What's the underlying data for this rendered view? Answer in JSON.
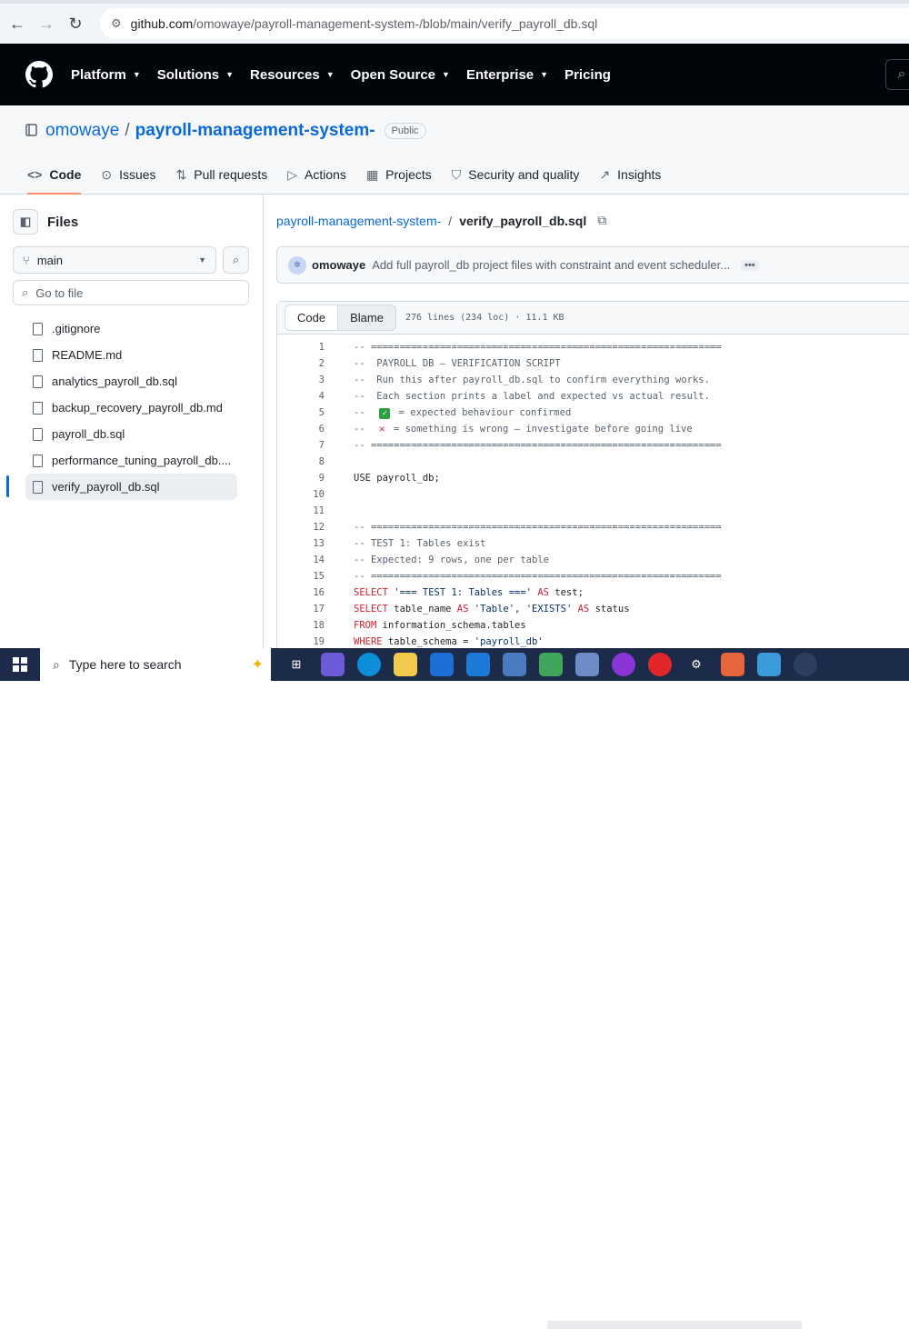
{
  "browser": {
    "url_host": "github.com",
    "url_path": "/omowaye/payroll-management-system-/blob/main/verify_payroll_db.sql"
  },
  "gh_nav": {
    "items": [
      "Platform",
      "Solutions",
      "Resources",
      "Open Source",
      "Enterprise",
      "Pricing"
    ]
  },
  "repo": {
    "owner": "omowaye",
    "name": "payroll-management-system-",
    "visibility": "Public"
  },
  "tabs": [
    "Code",
    "Issues",
    "Pull requests",
    "Actions",
    "Projects",
    "Security and quality",
    "Insights"
  ],
  "sidebar": {
    "title": "Files",
    "branch": "main",
    "goto_placeholder": "Go to file",
    "files": [
      ".gitignore",
      "README.md",
      "analytics_payroll_db.sql",
      "backup_recovery_payroll_db.md",
      "payroll_db.sql",
      "performance_tuning_payroll_db....",
      "verify_payroll_db.sql"
    ]
  },
  "breadcrumb": {
    "repo": "payroll-management-system-",
    "separator": "/",
    "file": "verify_payroll_db.sql"
  },
  "commit": {
    "author": "omowaye",
    "message": "Add full payroll_db project files with constraint and event scheduler...",
    "more": "•••"
  },
  "code_view": {
    "code_tab": "Code",
    "blame_tab": "Blame",
    "meta": "276 lines (234 loc) · 11.1 KB"
  },
  "code_lines": [
    {
      "n": "1",
      "t": "-- ============================================================="
    },
    {
      "n": "2",
      "t": "--  PAYROLL DB — VERIFICATION SCRIPT"
    },
    {
      "n": "3",
      "t": "--  Run this after payroll_db.sql to confirm everything works."
    },
    {
      "n": "4",
      "t": "--  Each section prints a label and expected vs actual result."
    },
    {
      "n": "5",
      "t": "--  ✅ = expected behaviour confirmed"
    },
    {
      "n": "6",
      "t": "--  ❌ = something is wrong — investigate before going live"
    },
    {
      "n": "7",
      "t": "-- ============================================================="
    },
    {
      "n": "8",
      "t": ""
    },
    {
      "n": "9",
      "t": "USE payroll_db;"
    },
    {
      "n": "10",
      "t": ""
    },
    {
      "n": "11",
      "t": ""
    },
    {
      "n": "12",
      "t": "-- ============================================================="
    },
    {
      "n": "13",
      "t": "-- TEST 1: Tables exist"
    },
    {
      "n": "14",
      "t": "-- Expected: 9 rows, one per table"
    },
    {
      "n": "15",
      "t": "-- ============================================================="
    },
    {
      "n": "16",
      "t": "SELECT '=== TEST 1: Tables ===' AS test;"
    },
    {
      "n": "17",
      "t": "SELECT table_name AS 'Table', 'EXISTS' AS status"
    },
    {
      "n": "18",
      "t": "FROM information_schema.tables"
    },
    {
      "n": "19",
      "t": "WHERE table_schema = 'payroll_db'"
    }
  ],
  "taskbar": {
    "search_placeholder": "Type here to search"
  },
  "colors": {
    "accent": "#0969da",
    "header_bg": "#010409",
    "tab_underline": "#fd8c73",
    "taskbar_bg": "#1c2b4a"
  }
}
